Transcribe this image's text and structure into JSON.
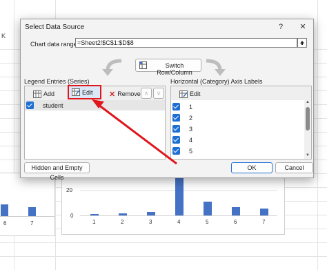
{
  "background": {
    "col_header": "K",
    "left_x_ticks": [
      "6",
      "7"
    ],
    "chart_x_ticks": [
      "1",
      "2",
      "3",
      "4",
      "5",
      "6",
      "7"
    ],
    "chart_y_ticks": [
      "20",
      "0"
    ],
    "accent": "#4472c4"
  },
  "dialog": {
    "title": "Select Data Source",
    "help_label": "?",
    "close_label": "✕",
    "range_label": "Chart data range:",
    "range_value": "=Sheet2!$C$1:$D$8",
    "switch_label": "Switch Row/Column",
    "legend": {
      "heading": "Legend Entries (Series)",
      "add_label": "Add",
      "edit_label": "Edit",
      "remove_label": "Remove",
      "series": [
        "student"
      ]
    },
    "axis": {
      "heading": "Horizontal (Category) Axis Labels",
      "edit_label": "Edit",
      "items": [
        "1",
        "2",
        "3",
        "4",
        "5"
      ]
    },
    "hidden_label": "Hidden and Empty Cells",
    "ok_label": "OK",
    "cancel_label": "Cancel",
    "highlight_color": "#e0161d"
  }
}
